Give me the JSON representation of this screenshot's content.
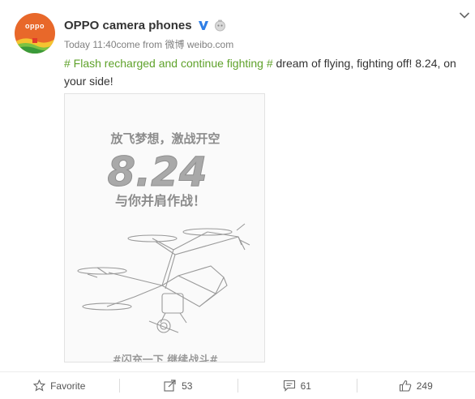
{
  "post": {
    "author": {
      "name": "OPPO camera phones",
      "avatar_text": "oppo"
    },
    "time": "Today 11:40",
    "from_label": "come from",
    "source": "微博 weibo.com",
    "topic": "# Flash recharged and continue fighting #",
    "text": " dream of flying, fighting off! 8.24, on your side!",
    "image_text": {
      "line1": "放飞梦想，激战开空",
      "date": "8.24",
      "line2": "与你并肩作战！",
      "bottom": "#闪充一下 继续战斗#"
    }
  },
  "actions": {
    "favorite": "Favorite",
    "repost_count": "53",
    "comment_count": "61",
    "like_count": "249"
  },
  "colors": {
    "topic": "#5fa22b",
    "verified": "#2e7ee6",
    "avatar": "#e8682a"
  }
}
